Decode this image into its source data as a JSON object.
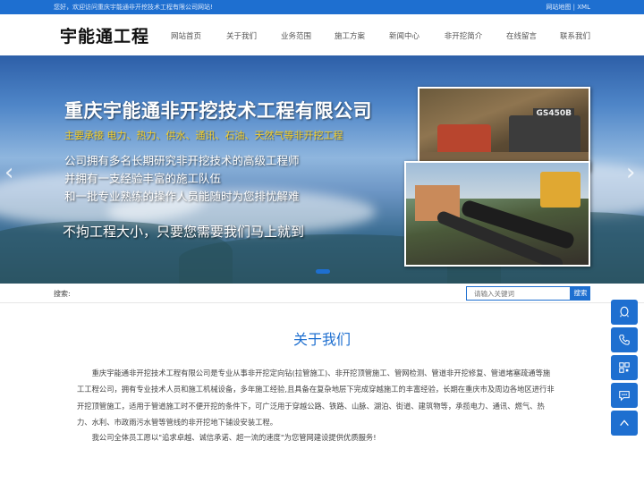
{
  "topbar": {
    "welcome": "您好，欢迎访问重庆宇能通非开挖技术工程有限公司网站!",
    "sitemap": "网站地图",
    "separator": "|",
    "xml": "XML"
  },
  "header": {
    "logo": "宇能通工程",
    "nav": [
      "网站首页",
      "关于我们",
      "业务范围",
      "施工方案",
      "新闻中心",
      "非开挖简介",
      "在线留言",
      "联系我们"
    ]
  },
  "banner": {
    "title": "重庆宇能通非开挖技术工程有限公司",
    "subtitle": "主要承接 电力、热力、供水、通讯、石油、天然气等非开挖工程",
    "lines": [
      "公司拥有多名长期研究非开挖技术的高级工程师",
      "并拥有一支经验丰富的施工队伍",
      "和一批专业熟练的操作人员能随时为您排忧解难"
    ],
    "slogan": "不拘工程大小，只要您需要我们马上就到",
    "machine_label": "GS450B",
    "prev_arrow": "‹",
    "next_arrow": "›"
  },
  "search": {
    "label": "搜索:",
    "placeholder": "请输入关键词",
    "button": "搜索"
  },
  "about": {
    "title": "关于我们",
    "paragraph1": "重庆宇能通非开挖技术工程有限公司是专业从事非开挖定向钻(拉管施工)、非开挖顶管施工、管网检测、管道非开挖修复、管道堵塞疏通等施工工程公司，拥有专业技术人员和施工机械设备，多年施工经验,且具备在复杂地层下完成穿越施工的丰富经验，长期在重庆市及周边各地区进行非开挖顶管施工，适用于管道施工时不便开挖的条件下，可广泛用于穿越公路、铁路、山脉、湖泊、街道、建筑物等，承揽电力、通讯、燃气、热力、水利、市政雨污水管等管线的非开挖地下铺设安装工程。",
    "paragraph2": "我公司全体员工愿以\"追求卓越、诚信承诺、超一流的速度\"为您管网建设提供优质服务!"
  },
  "float_bar": {
    "icons": [
      "qq-icon",
      "phone-icon",
      "qrcode-icon",
      "message-icon",
      "back-to-top-icon"
    ]
  },
  "colors": {
    "brand": "#1e6fd0",
    "subtitle_yellow": "#f5d02a"
  }
}
